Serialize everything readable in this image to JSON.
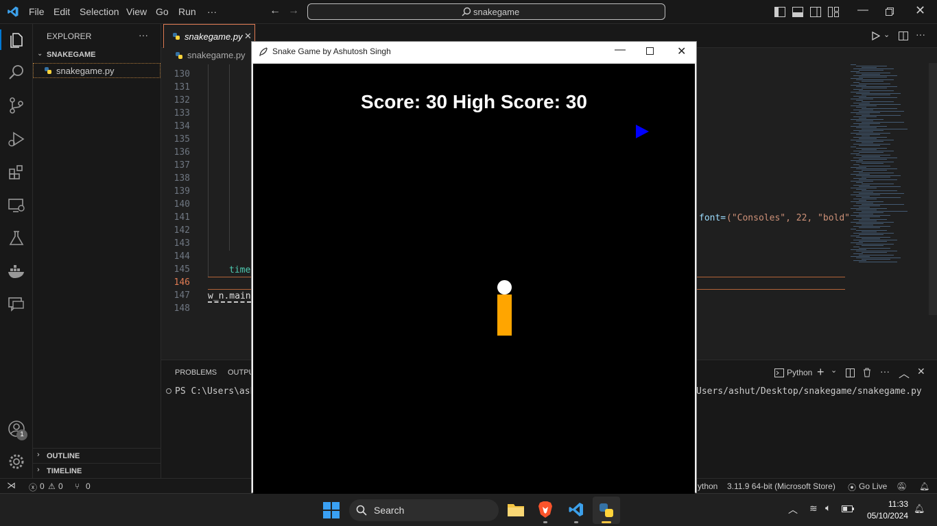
{
  "menu": {
    "file": "File",
    "edit": "Edit",
    "selection": "Selection",
    "view": "View",
    "go": "Go",
    "run": "Run",
    "more": "···"
  },
  "command_center": {
    "text": "snakegame"
  },
  "sidebar": {
    "header": "EXPLORER",
    "more": "···",
    "folder": "SNAKEGAME",
    "file": "snakegame.py",
    "outline": "OUTLINE",
    "timeline": "TIMELINE"
  },
  "editor": {
    "tab_label": "snakegame.py",
    "breadcrumb": "snakegame.py",
    "line_numbers": [
      "130",
      "131",
      "132",
      "133",
      "134",
      "135",
      "136",
      "137",
      "138",
      "139",
      "140",
      "141",
      "142",
      "143",
      "144",
      "145",
      "146",
      "147",
      "148"
    ],
    "current_line": "146",
    "line_145_code": "time",
    "line_147_code": "w_n.main",
    "line_141_tail_kw": "font=",
    "line_141_tail_args": "(\"Consoles\", 22, \"bold\""
  },
  "panel": {
    "tab_problems": "PROBLEMS",
    "tab_output": "OUTPU",
    "terminal_kind": "Python",
    "terminal_prompt": "PS C:\\Users\\ashu",
    "terminal_tail": "Users/ashut/Desktop/snakegame/snakegame.py"
  },
  "statusbar": {
    "errors": "0",
    "warnings": "0",
    "ports": "0",
    "language": "ython",
    "interpreter": "3.11.9 64-bit (Microsoft Store)",
    "golive": "Go Live"
  },
  "game": {
    "window_title": "Snake Game by Ashutosh Singh",
    "score_text": "Score: 30 High Score: 30",
    "colors": {
      "head": "#ffffff",
      "body": "#ffa500",
      "food": "#0000ff",
      "background": "#000000"
    }
  },
  "taskbar": {
    "search_placeholder": "Search",
    "time": "11:33",
    "date": "05/10/2024"
  },
  "accounts_badge": "1"
}
